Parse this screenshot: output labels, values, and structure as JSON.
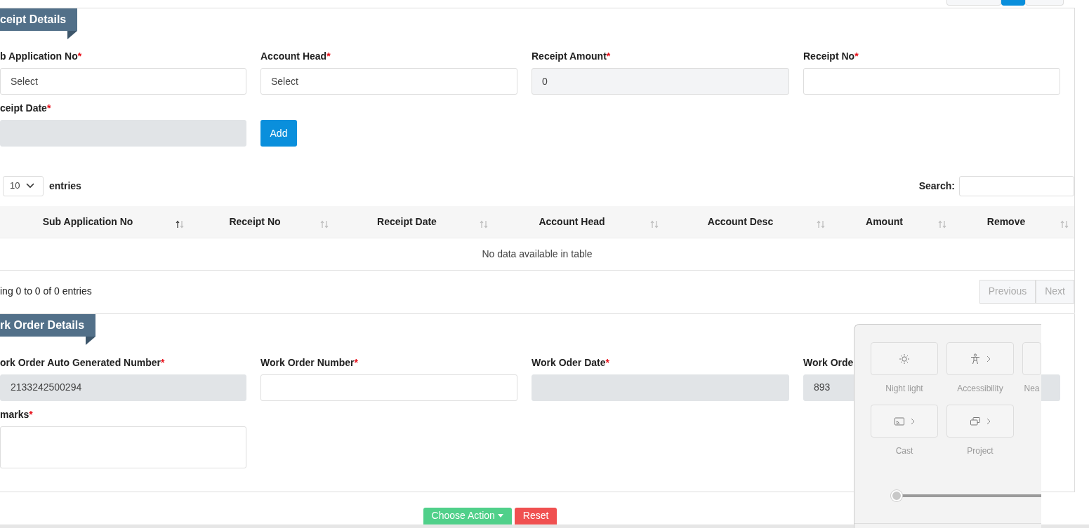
{
  "top_buttons": [
    {
      "selected": false
    },
    {
      "selected": true
    },
    {
      "selected": false
    }
  ],
  "receipt_section": {
    "title": "ceipt Details",
    "fields": [
      {
        "label": "b Application No",
        "required_mark": "*",
        "kind": "select",
        "value": "Select"
      },
      {
        "label": "Account Head",
        "required_mark": "*",
        "kind": "select",
        "value": "Select"
      },
      {
        "label": "Receipt Amount",
        "required_mark": "*",
        "kind": "readonly",
        "value": "0"
      },
      {
        "label": "Receipt No",
        "required_mark": "*",
        "kind": "input"
      },
      {
        "label": "ceipt Date",
        "required_mark": "*",
        "kind": "disabled"
      }
    ],
    "add_button": "Add"
  },
  "table": {
    "length_value": "10",
    "length_label": "entries",
    "search_label": "Search:",
    "columns": [
      {
        "label": "Sub Application No",
        "sorted": true
      },
      {
        "label": "Receipt No",
        "sorted": false
      },
      {
        "label": "Receipt Date",
        "sorted": false
      },
      {
        "label": "Account Head",
        "sorted": false
      },
      {
        "label": "Account Desc",
        "sorted": false
      },
      {
        "label": "Amount",
        "sorted": false
      },
      {
        "label": "Remove",
        "sorted": false
      }
    ],
    "empty_message": "No data available in table",
    "info": "ing 0 to 0 of 0 entries",
    "pagination": [
      {
        "label": "Previous",
        "disabled": true
      },
      {
        "label": "Next",
        "disabled": true
      }
    ]
  },
  "work_order_section": {
    "title": "rk Order Details",
    "fields": [
      {
        "label": "ork Order Auto Generated Number",
        "required_mark": "*",
        "kind": "disabled",
        "value": "2133242500294"
      },
      {
        "label": "Work Order Number",
        "required_mark": "*",
        "kind": "input"
      },
      {
        "label": "Work Oder Date",
        "required_mark": "*",
        "kind": "disabled"
      },
      {
        "label": "Work Orde",
        "kind": "disabled",
        "value": "893"
      },
      {
        "label": "marks",
        "required_mark": "*",
        "kind": "textarea"
      }
    ]
  },
  "actions": [
    {
      "label": "Choose Action",
      "kind": "dropdown"
    },
    {
      "label": "Reset",
      "kind": "reset"
    }
  ],
  "quick_settings": {
    "tiles": [
      {
        "label": "Night light",
        "arrow": false
      },
      {
        "label": "Accessibility",
        "arrow": true
      },
      {
        "label": "Nea",
        "arrow": false
      },
      {
        "label": "Cast",
        "arrow": true
      },
      {
        "label": "Project",
        "arrow": true
      }
    ],
    "slider": {
      "level": 0
    }
  }
}
